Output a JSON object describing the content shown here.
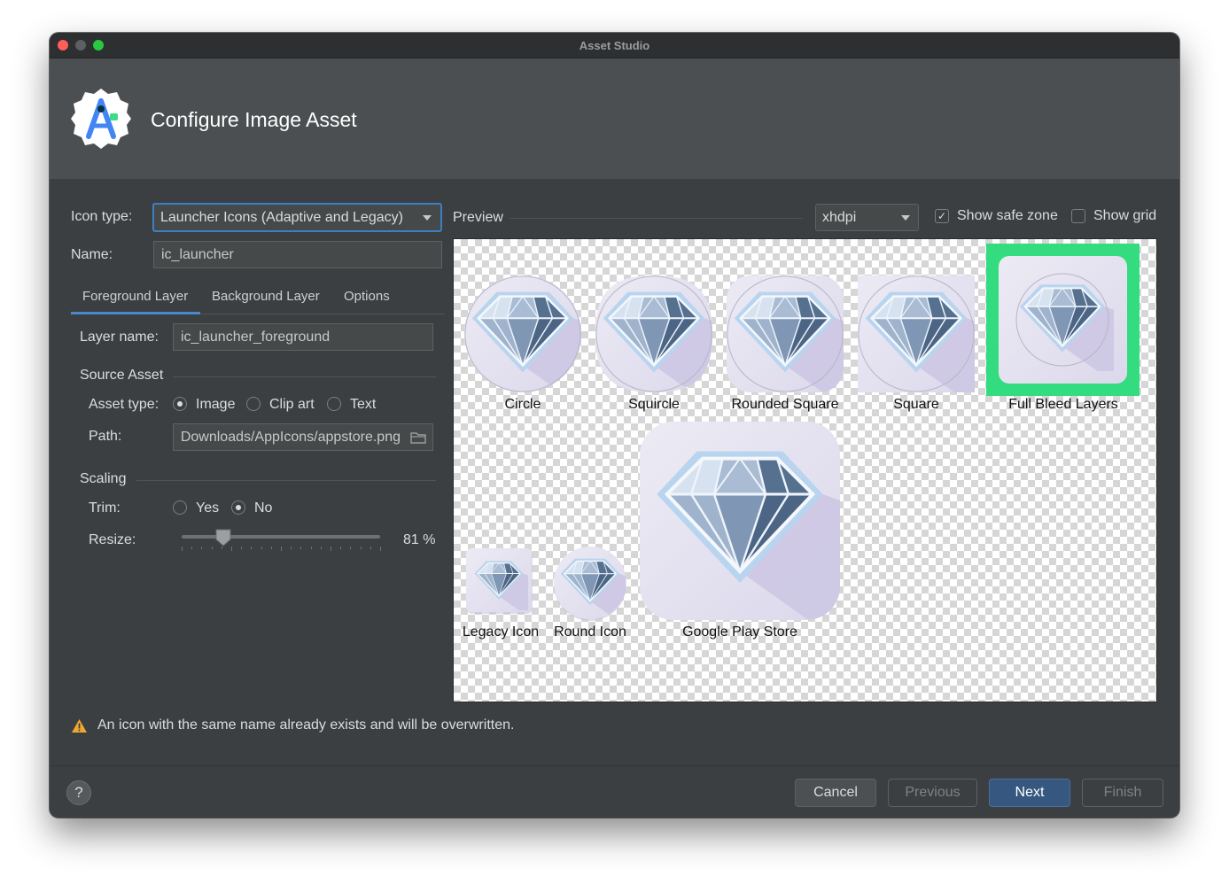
{
  "window": {
    "title": "Asset Studio"
  },
  "header": {
    "title": "Configure Image Asset"
  },
  "form": {
    "icon_type_label": "Icon type:",
    "icon_type_value": "Launcher Icons (Adaptive and Legacy)",
    "name_label": "Name:",
    "name_value": "ic_launcher"
  },
  "tabs": [
    {
      "label": "Foreground Layer",
      "selected": true
    },
    {
      "label": "Background Layer",
      "selected": false
    },
    {
      "label": "Options",
      "selected": false
    }
  ],
  "layer": {
    "name_label": "Layer name:",
    "name_value": "ic_launcher_foreground",
    "source_section": "Source Asset",
    "asset_type_label": "Asset type:",
    "asset_types": [
      "Image",
      "Clip art",
      "Text"
    ],
    "asset_type_selected": "Image",
    "path_label": "Path:",
    "path_value": "Downloads/AppIcons/appstore.png",
    "scaling_section": "Scaling",
    "trim_label": "Trim:",
    "trim_options": [
      "Yes",
      "No"
    ],
    "trim_selected": "No",
    "resize_label": "Resize:",
    "resize_value": "81 %",
    "resize_percent": 81
  },
  "preview": {
    "label": "Preview",
    "density": "xhdpi",
    "show_safe_zone_label": "Show safe zone",
    "show_safe_zone": true,
    "show_grid_label": "Show grid",
    "show_grid": false,
    "icons": [
      "Circle",
      "Squircle",
      "Rounded Square",
      "Square",
      "Full Bleed Layers",
      "Legacy Icon",
      "Round Icon",
      "Google Play Store"
    ]
  },
  "warning": {
    "text": "An icon with the same name already exists and will be overwritten."
  },
  "footer": {
    "help": "?",
    "cancel": "Cancel",
    "previous": "Previous",
    "next": "Next",
    "finish": "Finish"
  },
  "colors": {
    "accent": "#3d7fc4",
    "safe_zone": "#33dd7f",
    "primary_button": "#365880"
  },
  "icon_names": {
    "logo": "android-studio-logo-icon",
    "warning": "warning-icon",
    "folder": "folder-icon"
  }
}
